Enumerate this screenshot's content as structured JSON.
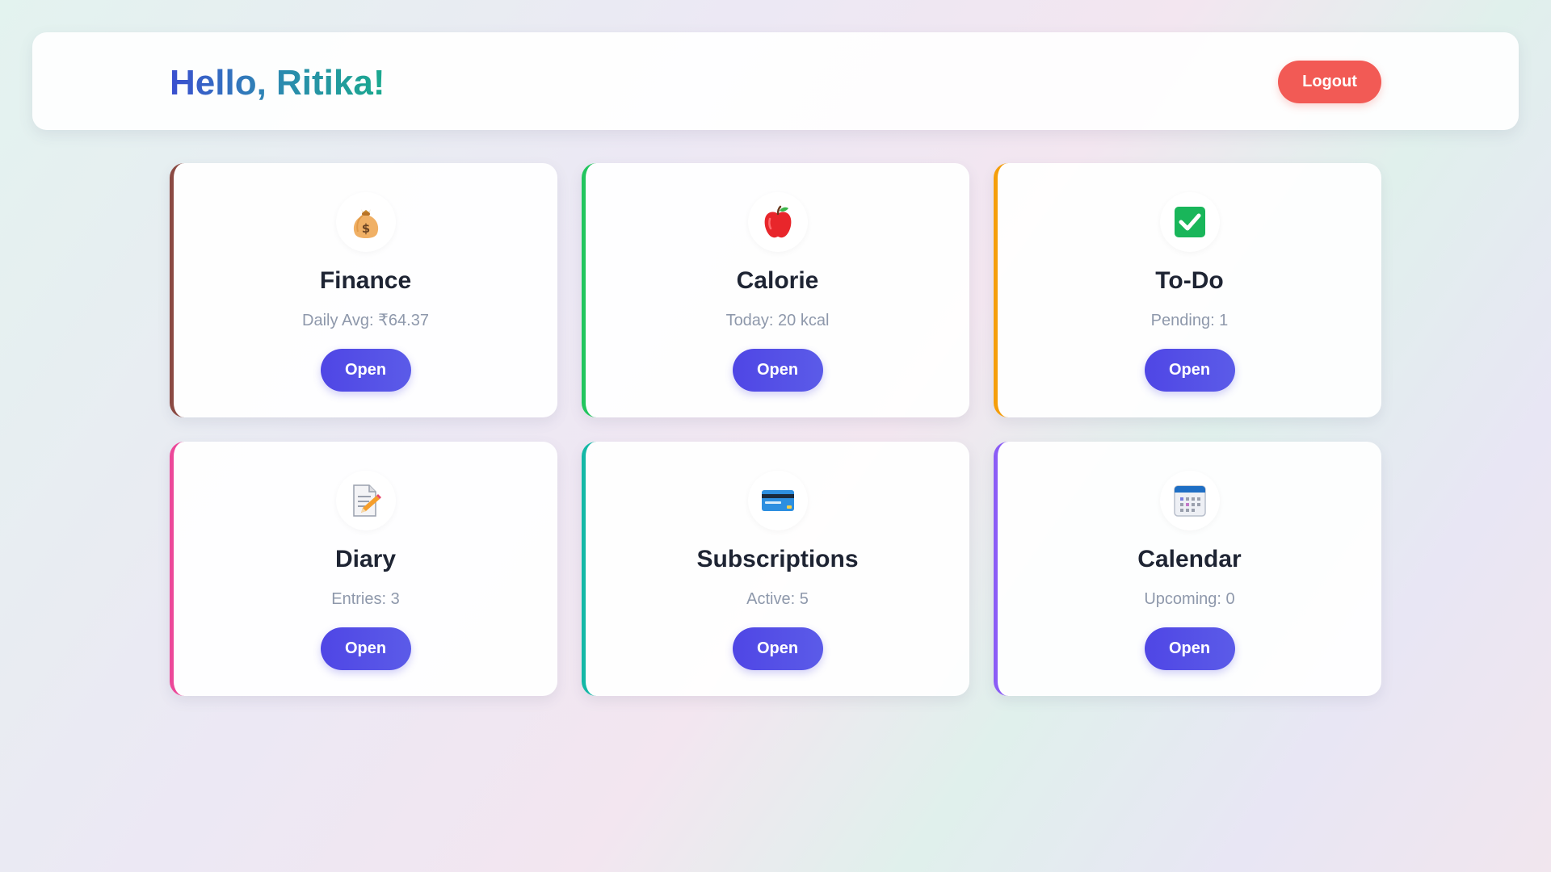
{
  "header": {
    "greeting": "Hello, Ritika!",
    "logout_label": "Logout"
  },
  "cards": [
    {
      "title": "Finance",
      "stat": "Daily Avg: ₹64.37",
      "button": "Open",
      "icon": "money-bag-icon",
      "accent": "#8b4a43"
    },
    {
      "title": "Calorie",
      "stat": "Today: 20 kcal",
      "button": "Open",
      "icon": "apple-icon",
      "accent": "#22c55e"
    },
    {
      "title": "To-Do",
      "stat": "Pending: 1",
      "button": "Open",
      "icon": "check-box-icon",
      "accent": "#f59e0b"
    },
    {
      "title": "Diary",
      "stat": "Entries: 3",
      "button": "Open",
      "icon": "memo-icon",
      "accent": "#ec4899"
    },
    {
      "title": "Subscriptions",
      "stat": "Active: 5",
      "button": "Open",
      "icon": "credit-card-icon",
      "accent": "#14b8a6"
    },
    {
      "title": "Calendar",
      "stat": "Upcoming: 0",
      "button": "Open",
      "icon": "calendar-icon",
      "accent": "#8b5cf6"
    }
  ],
  "colors": {
    "logout": "#f25a55",
    "primary_button": "#4f46e5"
  }
}
